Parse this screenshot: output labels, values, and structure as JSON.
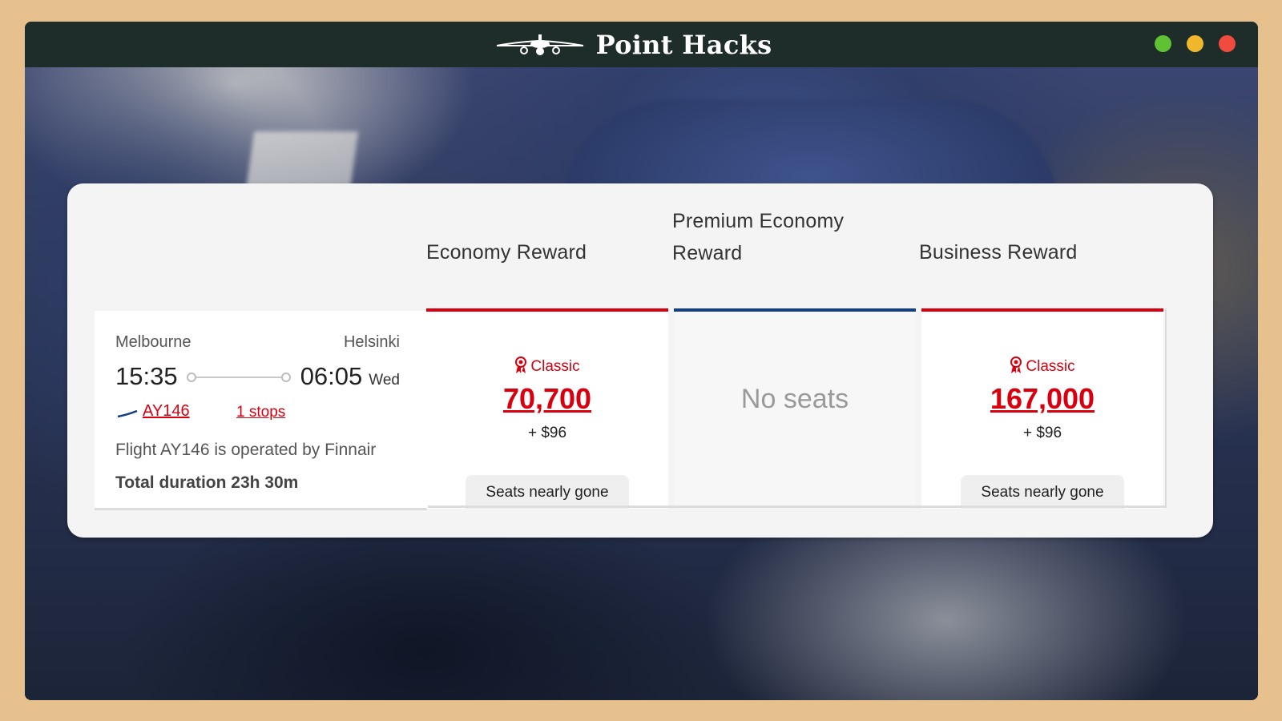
{
  "app": {
    "brand": "Point Hacks",
    "window_controls": [
      "minimize",
      "maximize",
      "close"
    ]
  },
  "columns": {
    "economy": "Economy Reward",
    "premium_line1": "Premium Economy",
    "premium_line2": "Reward",
    "business": "Business Reward"
  },
  "flight": {
    "origin": "Melbourne",
    "destination": "Helsinki",
    "depart_time": "15:35",
    "arrive_time": "06:05",
    "arrive_day": "Wed",
    "flight_number": "AY146",
    "stops": "1 stops",
    "operated_by": "Flight AY146 is operated by Finnair",
    "duration": "Total duration 23h 30m"
  },
  "fares": {
    "economy": {
      "tag": "Classic",
      "points": "70,700",
      "tax": "+ $96",
      "status": "Seats nearly gone"
    },
    "premium": {
      "message": "No seats"
    },
    "business": {
      "tag": "Classic",
      "points": "167,000",
      "tax": "+ $96",
      "status": "Seats nearly gone"
    }
  },
  "colors": {
    "accent_red": "#d8000f",
    "premium_blue": "#123e84",
    "titlebar": "#1f2d2a",
    "background": "#e6c08d"
  }
}
